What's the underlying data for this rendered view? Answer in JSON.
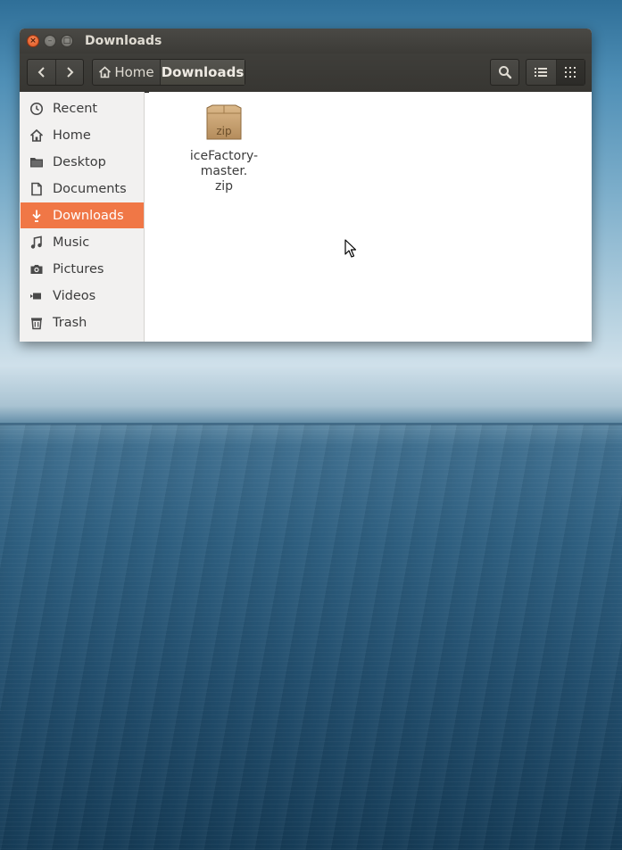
{
  "window": {
    "title": "Downloads"
  },
  "titlebar": {
    "close_glyph": "×",
    "minimize_glyph": "–",
    "maximize_glyph": "□"
  },
  "toolbar": {
    "back_icon": "chevron-left-icon",
    "forward_icon": "chevron-right-icon",
    "path": [
      {
        "label": "Home",
        "icon": "home-icon"
      },
      {
        "label": "Downloads"
      }
    ],
    "search_icon": "search-icon",
    "list_view_icon": "list-view-icon",
    "grid_view_icon": "grid-view-icon",
    "active_view": "grid"
  },
  "sidebar": {
    "items": [
      {
        "label": "Recent",
        "icon": "clock-icon"
      },
      {
        "label": "Home",
        "icon": "home-icon"
      },
      {
        "label": "Desktop",
        "icon": "folder-icon"
      },
      {
        "label": "Documents",
        "icon": "document-icon"
      },
      {
        "label": "Downloads",
        "icon": "download-icon",
        "selected": true
      },
      {
        "label": "Music",
        "icon": "music-note-icon"
      },
      {
        "label": "Pictures",
        "icon": "camera-icon"
      },
      {
        "label": "Videos",
        "icon": "video-icon"
      },
      {
        "label": "Trash",
        "icon": "trash-icon"
      }
    ],
    "selected_color": "#f07746"
  },
  "files": [
    {
      "name_line1": "iceFactory-master.",
      "name_line2": "zip",
      "icon": "zip-archive-icon",
      "icon_label": "zip"
    }
  ],
  "colors": {
    "titlebar": "#3c3b37",
    "accent": "#f07746",
    "sidebar_bg": "#f2f1f0"
  }
}
